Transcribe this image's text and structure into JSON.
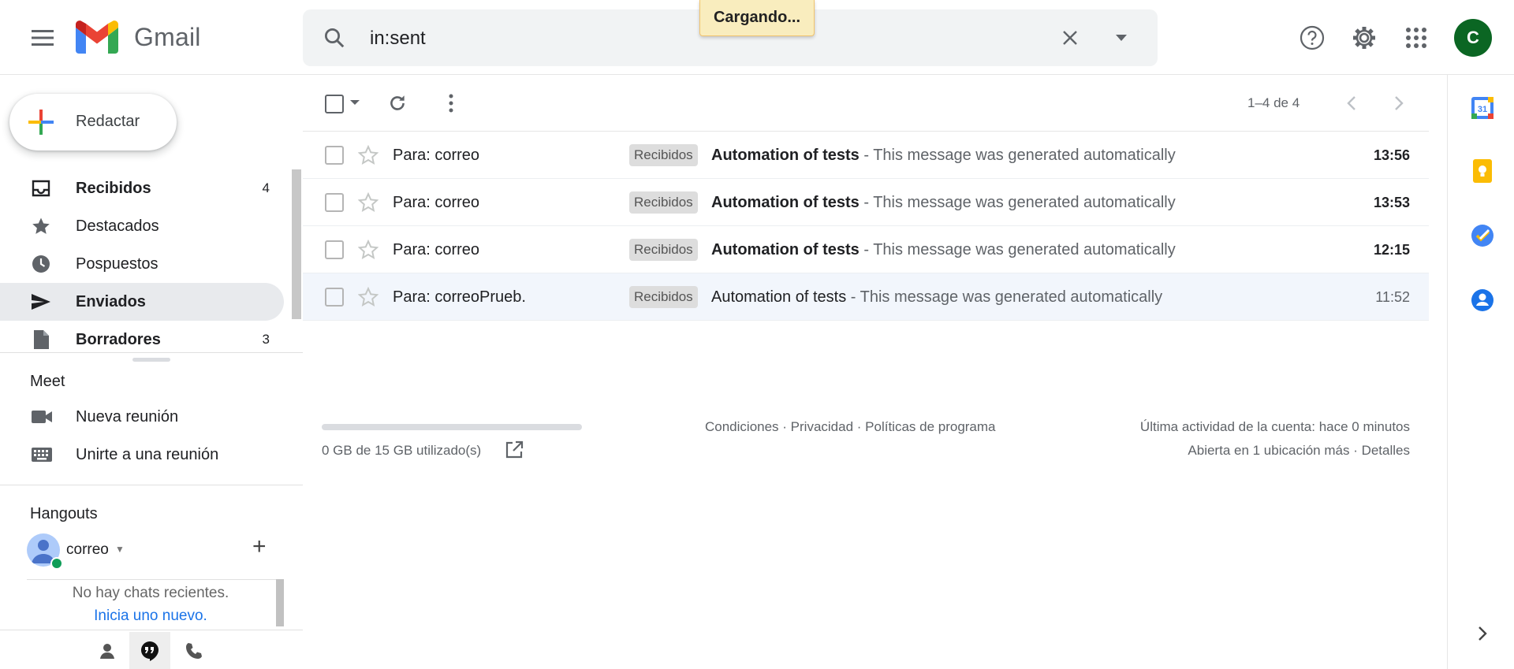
{
  "app": {
    "name": "Gmail"
  },
  "search": {
    "value": "in:sent"
  },
  "loading": {
    "text": "Cargando..."
  },
  "account": {
    "initial": "C"
  },
  "compose": {
    "label": "Redactar"
  },
  "nav": {
    "items": [
      {
        "label": "Recibidos",
        "count": "4",
        "bold": true
      },
      {
        "label": "Destacados",
        "count": "",
        "bold": false
      },
      {
        "label": "Pospuestos",
        "count": "",
        "bold": false
      },
      {
        "label": "Enviados",
        "count": "",
        "bold": true
      },
      {
        "label": "Borradores",
        "count": "3",
        "bold": true
      }
    ]
  },
  "meet": {
    "title": "Meet",
    "new_meeting": "Nueva reunión",
    "join_meeting": "Unirte a una reunión"
  },
  "hangouts": {
    "title": "Hangouts",
    "user": "correo",
    "no_chats": "No hay chats recientes.",
    "start_new": "Inicia uno nuevo."
  },
  "toolbar": {
    "pager": "1–4 de 4"
  },
  "mails": [
    {
      "from": "Para: correo",
      "label": "Recibidos",
      "subject": "Automation of tests",
      "snippet": " - This message was generated automatically",
      "time": "13:56",
      "read": false
    },
    {
      "from": "Para: correo",
      "label": "Recibidos",
      "subject": "Automation of tests",
      "snippet": " - This message was generated automatically",
      "time": "13:53",
      "read": false
    },
    {
      "from": "Para: correo",
      "label": "Recibidos",
      "subject": "Automation of tests",
      "snippet": " - This message was generated automatically",
      "time": "12:15",
      "read": false
    },
    {
      "from": "Para: correoPrueb.",
      "label": "Recibidos",
      "subject": "Automation of tests",
      "snippet": " - This message was generated automatically",
      "time": "11:52",
      "read": true
    }
  ],
  "footer": {
    "storage": "0 GB de 15 GB utilizado(s)",
    "storage_fraction": 0.0,
    "links": "Condiciones · Privacidad · Políticas de programa",
    "activity": "Última actividad de la cuenta: hace 0 minutos",
    "details": "Abierta en 1 ubicación más · Detalles"
  },
  "colors": {
    "accent_red": "#ea4335",
    "accent_blue": "#4285f4",
    "accent_yellow": "#fbbc04",
    "accent_green": "#34a853",
    "avatar_bg": "#0b6623"
  }
}
